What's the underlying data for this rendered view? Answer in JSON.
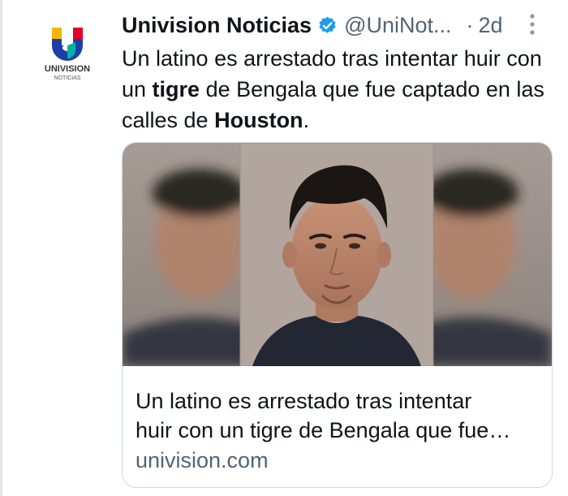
{
  "account": {
    "display_name": "Univision Noticias",
    "handle": "@UniNot...",
    "separator": "·",
    "time": "2d",
    "logo_line1": "UNIVISION",
    "logo_line2": "NOTICIAS"
  },
  "tweet": {
    "part1": "Un latino es arrestado tras intentar huir con un ",
    "bold1": "tigre",
    "part2": " de Bengala que fue captado en las calles de ",
    "bold2": "Houston",
    "part3": "."
  },
  "card": {
    "title_line1": "Un latino es arrestado tras intentar",
    "title_line2": "huir con un tigre de Bengala que fue…",
    "domain": "univision.com"
  },
  "icons": {
    "verified": "verified-badge-icon",
    "more": "more-options-icon"
  },
  "colors": {
    "verified_blue": "#1d9bf0",
    "secondary_text": "#536471",
    "logo_blue": "#1b3fa8",
    "logo_red": "#e4002b"
  }
}
